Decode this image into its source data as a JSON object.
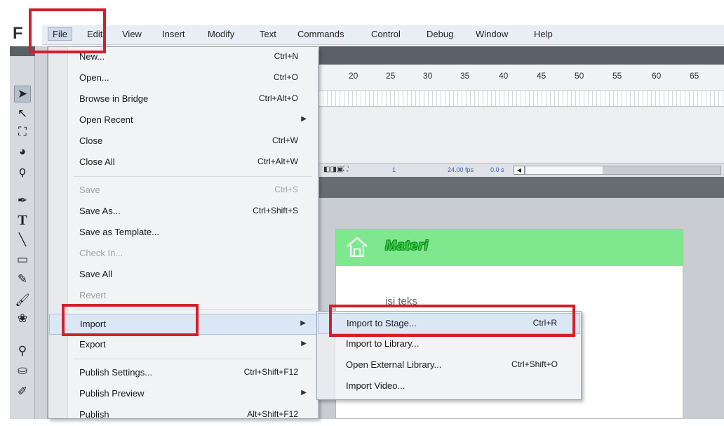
{
  "app": {
    "logo_letter": "F"
  },
  "menubar": {
    "items": [
      "File",
      "Edit",
      "View",
      "Insert",
      "Modify",
      "Text",
      "Commands",
      "Control",
      "Debug",
      "Window",
      "Help"
    ]
  },
  "timeline": {
    "frame_numbers": [
      "20",
      "25",
      "30",
      "35",
      "40",
      "45",
      "50",
      "55",
      "60",
      "65"
    ],
    "current_frame": "1",
    "fps": "24.00 fps",
    "time": "0.0 s"
  },
  "file_menu": {
    "items": [
      {
        "label": "New...",
        "shortcut": "Ctrl+N"
      },
      {
        "label": "Open...",
        "shortcut": "Ctrl+O"
      },
      {
        "label": "Browse in Bridge",
        "shortcut": "Ctrl+Alt+O"
      },
      {
        "label": "Open Recent",
        "submenu": true
      },
      {
        "label": "Close",
        "shortcut": "Ctrl+W"
      },
      {
        "label": "Close All",
        "shortcut": "Ctrl+Alt+W"
      },
      {
        "label": "Save",
        "shortcut": "Ctrl+S",
        "disabled": true
      },
      {
        "label": "Save As...",
        "shortcut": "Ctrl+Shift+S"
      },
      {
        "label": "Save as Template..."
      },
      {
        "label": "Check In...",
        "disabled": true
      },
      {
        "label": "Save All"
      },
      {
        "label": "Revert",
        "disabled": true
      },
      {
        "label": "Import",
        "submenu": true,
        "highlighted": true
      },
      {
        "label": "Export",
        "submenu": true
      },
      {
        "label": "Publish Settings...",
        "shortcut": "Ctrl+Shift+F12"
      },
      {
        "label": "Publish Preview",
        "submenu": true
      },
      {
        "label": "Publish",
        "shortcut": "Alt+Shift+F12"
      }
    ]
  },
  "import_submenu": {
    "items": [
      {
        "label": "Import to Stage...",
        "shortcut": "Ctrl+R",
        "highlighted": true
      },
      {
        "label": "Import to Library..."
      },
      {
        "label": "Open External Library...",
        "shortcut": "Ctrl+Shift+O"
      },
      {
        "label": "Import Video..."
      }
    ]
  },
  "stage": {
    "title": "Materi",
    "content_text": "isi teks",
    "header_color": "#7ee88e"
  },
  "highlight_color": "#d31f2a"
}
